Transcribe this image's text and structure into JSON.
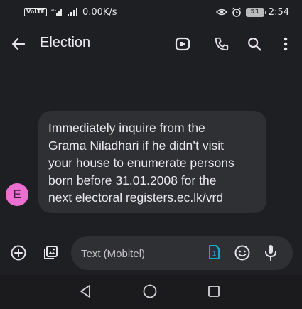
{
  "status_bar": {
    "volte": "VoLTE",
    "network_speed": "0.00K/s",
    "battery_level": "51",
    "time": "2:54",
    "icons": [
      "signal-4g-icon",
      "signal-icon",
      "eye-comfort-icon",
      "alarm-icon",
      "battery-icon"
    ]
  },
  "app_bar": {
    "title": "Election",
    "icons": [
      "back-arrow-icon",
      "video-call-icon",
      "phone-icon",
      "search-icon",
      "more-vert-icon"
    ]
  },
  "message": {
    "sender_initial": "E",
    "avatar_color": "#ec6fd0",
    "lines": [
      "Immediately inquire from the",
      "Grama Niladhari if he didn’t visit",
      "your house to enumerate persons",
      "born before 31.01.2008 for the",
      "next electoral registers.ec.lk/vrd"
    ]
  },
  "compose": {
    "placeholder": "Text (Mobitel)",
    "sim_number": "1",
    "accent_color": "#1ea7c9",
    "icons": [
      "add-icon",
      "gallery-icon",
      "sim-icon",
      "emoji-icon",
      "mic-icon"
    ]
  },
  "nav_bar": {
    "icons": [
      "nav-back-icon",
      "nav-home-icon",
      "nav-recents-icon"
    ]
  }
}
